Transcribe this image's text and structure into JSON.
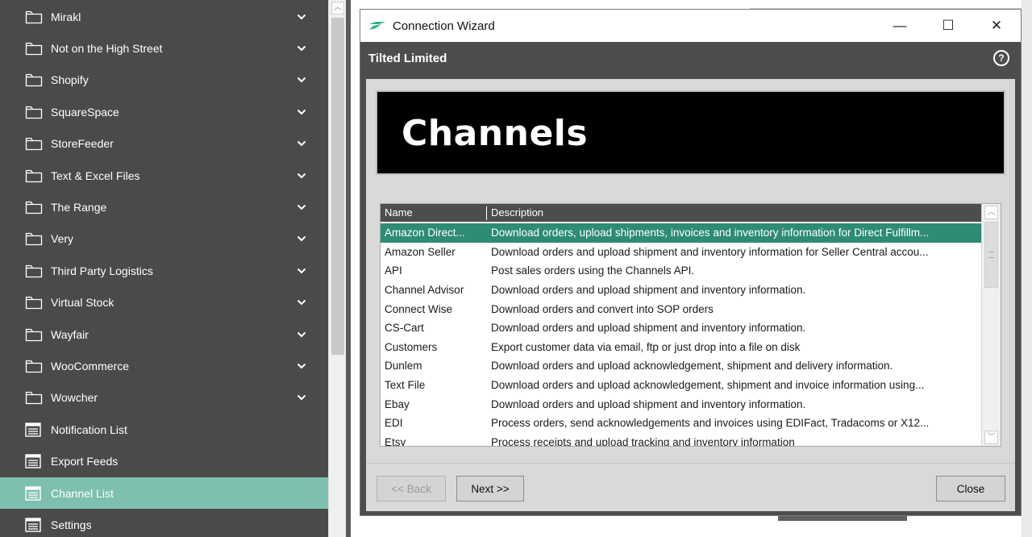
{
  "sidebar": {
    "items": [
      {
        "label": "Mirakl",
        "icon": "folder-icon",
        "chevron": "⌄"
      },
      {
        "label": "Not on the High Street",
        "icon": "folder-icon",
        "chevron": "⌄"
      },
      {
        "label": "Shopify",
        "icon": "folder-icon",
        "chevron": "⌄"
      },
      {
        "label": "SquareSpace",
        "icon": "folder-icon",
        "chevron": "⌄"
      },
      {
        "label": "StoreFeeder",
        "icon": "folder-icon",
        "chevron": "⌄"
      },
      {
        "label": "Text & Excel Files",
        "icon": "folder-icon",
        "chevron": "⌄"
      },
      {
        "label": "The Range",
        "icon": "folder-icon",
        "chevron": "⌄"
      },
      {
        "label": "Very",
        "icon": "folder-icon",
        "chevron": "⌄"
      },
      {
        "label": "Third Party Logistics",
        "icon": "folder-icon",
        "chevron": "⌄"
      },
      {
        "label": "Virtual Stock",
        "icon": "folder-icon",
        "chevron": "⌄"
      },
      {
        "label": "Wayfair",
        "icon": "folder-icon",
        "chevron": "⌄"
      },
      {
        "label": "WooCommerce",
        "icon": "folder-icon",
        "chevron": "⌄"
      },
      {
        "label": "Wowcher",
        "icon": "folder-icon",
        "chevron": "⌄"
      },
      {
        "label": "Notification List",
        "icon": "list-icon"
      },
      {
        "label": "Export Feeds",
        "icon": "list-icon"
      },
      {
        "label": "Channel List",
        "icon": "list-icon",
        "active": true
      },
      {
        "label": "Settings",
        "icon": "list-icon"
      }
    ],
    "active_color": "#7fbfb0"
  },
  "dialog": {
    "title": "Connection Wizard",
    "company": "Tilted Limited",
    "banner_title": "Channels",
    "controls": {
      "minimize": "—",
      "maximize": "☐",
      "close": "✕"
    },
    "help_glyph": "?",
    "list": {
      "col_name": "Name",
      "col_description": "Description",
      "rows": [
        {
          "name": "Amazon Direct...",
          "description": "Download orders, upload shipments, invoices and inventory information for Direct Fulfillm...",
          "selected": true
        },
        {
          "name": "Amazon Seller",
          "description": "Download orders and upload shipment and inventory information for Seller Central accou..."
        },
        {
          "name": "API",
          "description": "Post sales orders using the Channels API."
        },
        {
          "name": "Channel Advisor",
          "description": "Download orders and upload shipment and inventory information."
        },
        {
          "name": "Connect Wise",
          "description": "Download orders and convert into SOP orders"
        },
        {
          "name": "CS-Cart",
          "description": "Download orders and upload shipment and inventory information."
        },
        {
          "name": "Customers",
          "description": "Export customer data via email, ftp or just drop into a file on disk"
        },
        {
          "name": "Dunlem",
          "description": "Download orders and upload acknowledgement, shipment and delivery information."
        },
        {
          "name": "Text File",
          "description": "Download orders and upload acknowledgement, shipment and invoice information using..."
        },
        {
          "name": "Ebay",
          "description": "Download orders and upload shipment and inventory information."
        },
        {
          "name": "EDI",
          "description": "Process orders, send acknowledgements and invoices using EDIFact, Tradacoms or X12..."
        },
        {
          "name": "Etsy",
          "description": "Process receipts and upload tracking and inventory information"
        }
      ],
      "selected_color": "#2e8b75"
    },
    "buttons": {
      "back": "<< Back",
      "next": "Next >>",
      "close": "Close"
    }
  }
}
